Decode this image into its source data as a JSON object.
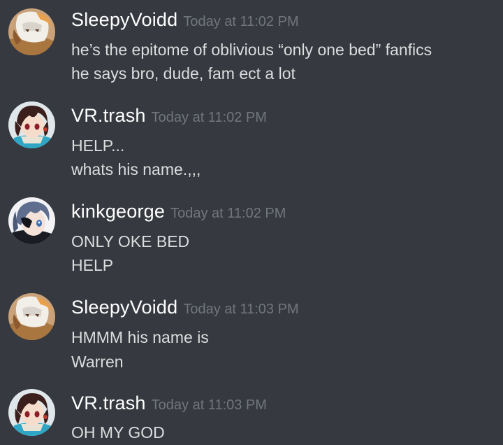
{
  "channel": {
    "messages": [
      {
        "author": "SleepyVoidd",
        "timestamp": "Today at 11:02 PM",
        "avatar_icon": "white-haired-character-avatar-icon",
        "lines": [
          "he’s the epitome of oblivious “only one bed” fanfics",
          "he says bro, dude, fam ect a lot"
        ]
      },
      {
        "author": "VR.trash",
        "timestamp": "Today at 11:02 PM",
        "avatar_icon": "dark-haired-anime-character-avatar-icon",
        "lines": [
          "HELP...",
          "whats his name.,,,"
        ]
      },
      {
        "author": "kinkgeorge",
        "timestamp": "Today at 11:02 PM",
        "avatar_icon": "blue-haired-eyepatch-character-avatar-icon",
        "lines": [
          "ONLY OKE BED",
          "HELP"
        ]
      },
      {
        "author": "SleepyVoidd",
        "timestamp": "Today at 11:03 PM",
        "avatar_icon": "white-haired-character-avatar-icon",
        "lines": [
          "HMMM his name is",
          "Warren"
        ]
      },
      {
        "author": "VR.trash",
        "timestamp": "Today at 11:03 PM",
        "avatar_icon": "dark-haired-anime-character-avatar-icon",
        "lines": [
          "OH MY GOD"
        ]
      }
    ]
  },
  "colors": {
    "background": "#36393f",
    "username": "#ffffff",
    "timestamp": "#72767d",
    "message_text": "#dcddde"
  }
}
